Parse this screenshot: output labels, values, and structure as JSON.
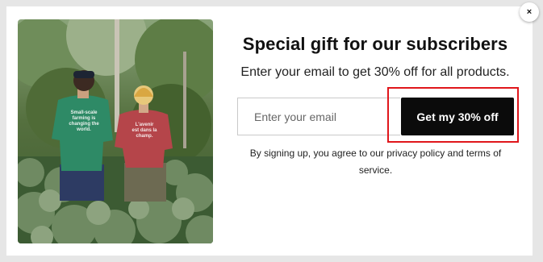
{
  "modal": {
    "close_icon": "×",
    "headline": "Special gift for our subscribers",
    "subtext": "Enter your email to get 30% off for all products.",
    "email_placeholder": "Enter your email",
    "email_value": "",
    "submit_label": "Get my 30% off",
    "disclaimer": "By signing up, you agree to our privacy policy and terms of service.",
    "photo": {
      "shirt_text_left": [
        "Small-scale",
        "farming is",
        "changing the",
        "world."
      ],
      "shirt_text_right": [
        "L'avenir",
        "est dans la",
        "champ."
      ]
    }
  },
  "colors": {
    "button_bg": "#0b0b0b",
    "highlight": "#e0161b"
  }
}
